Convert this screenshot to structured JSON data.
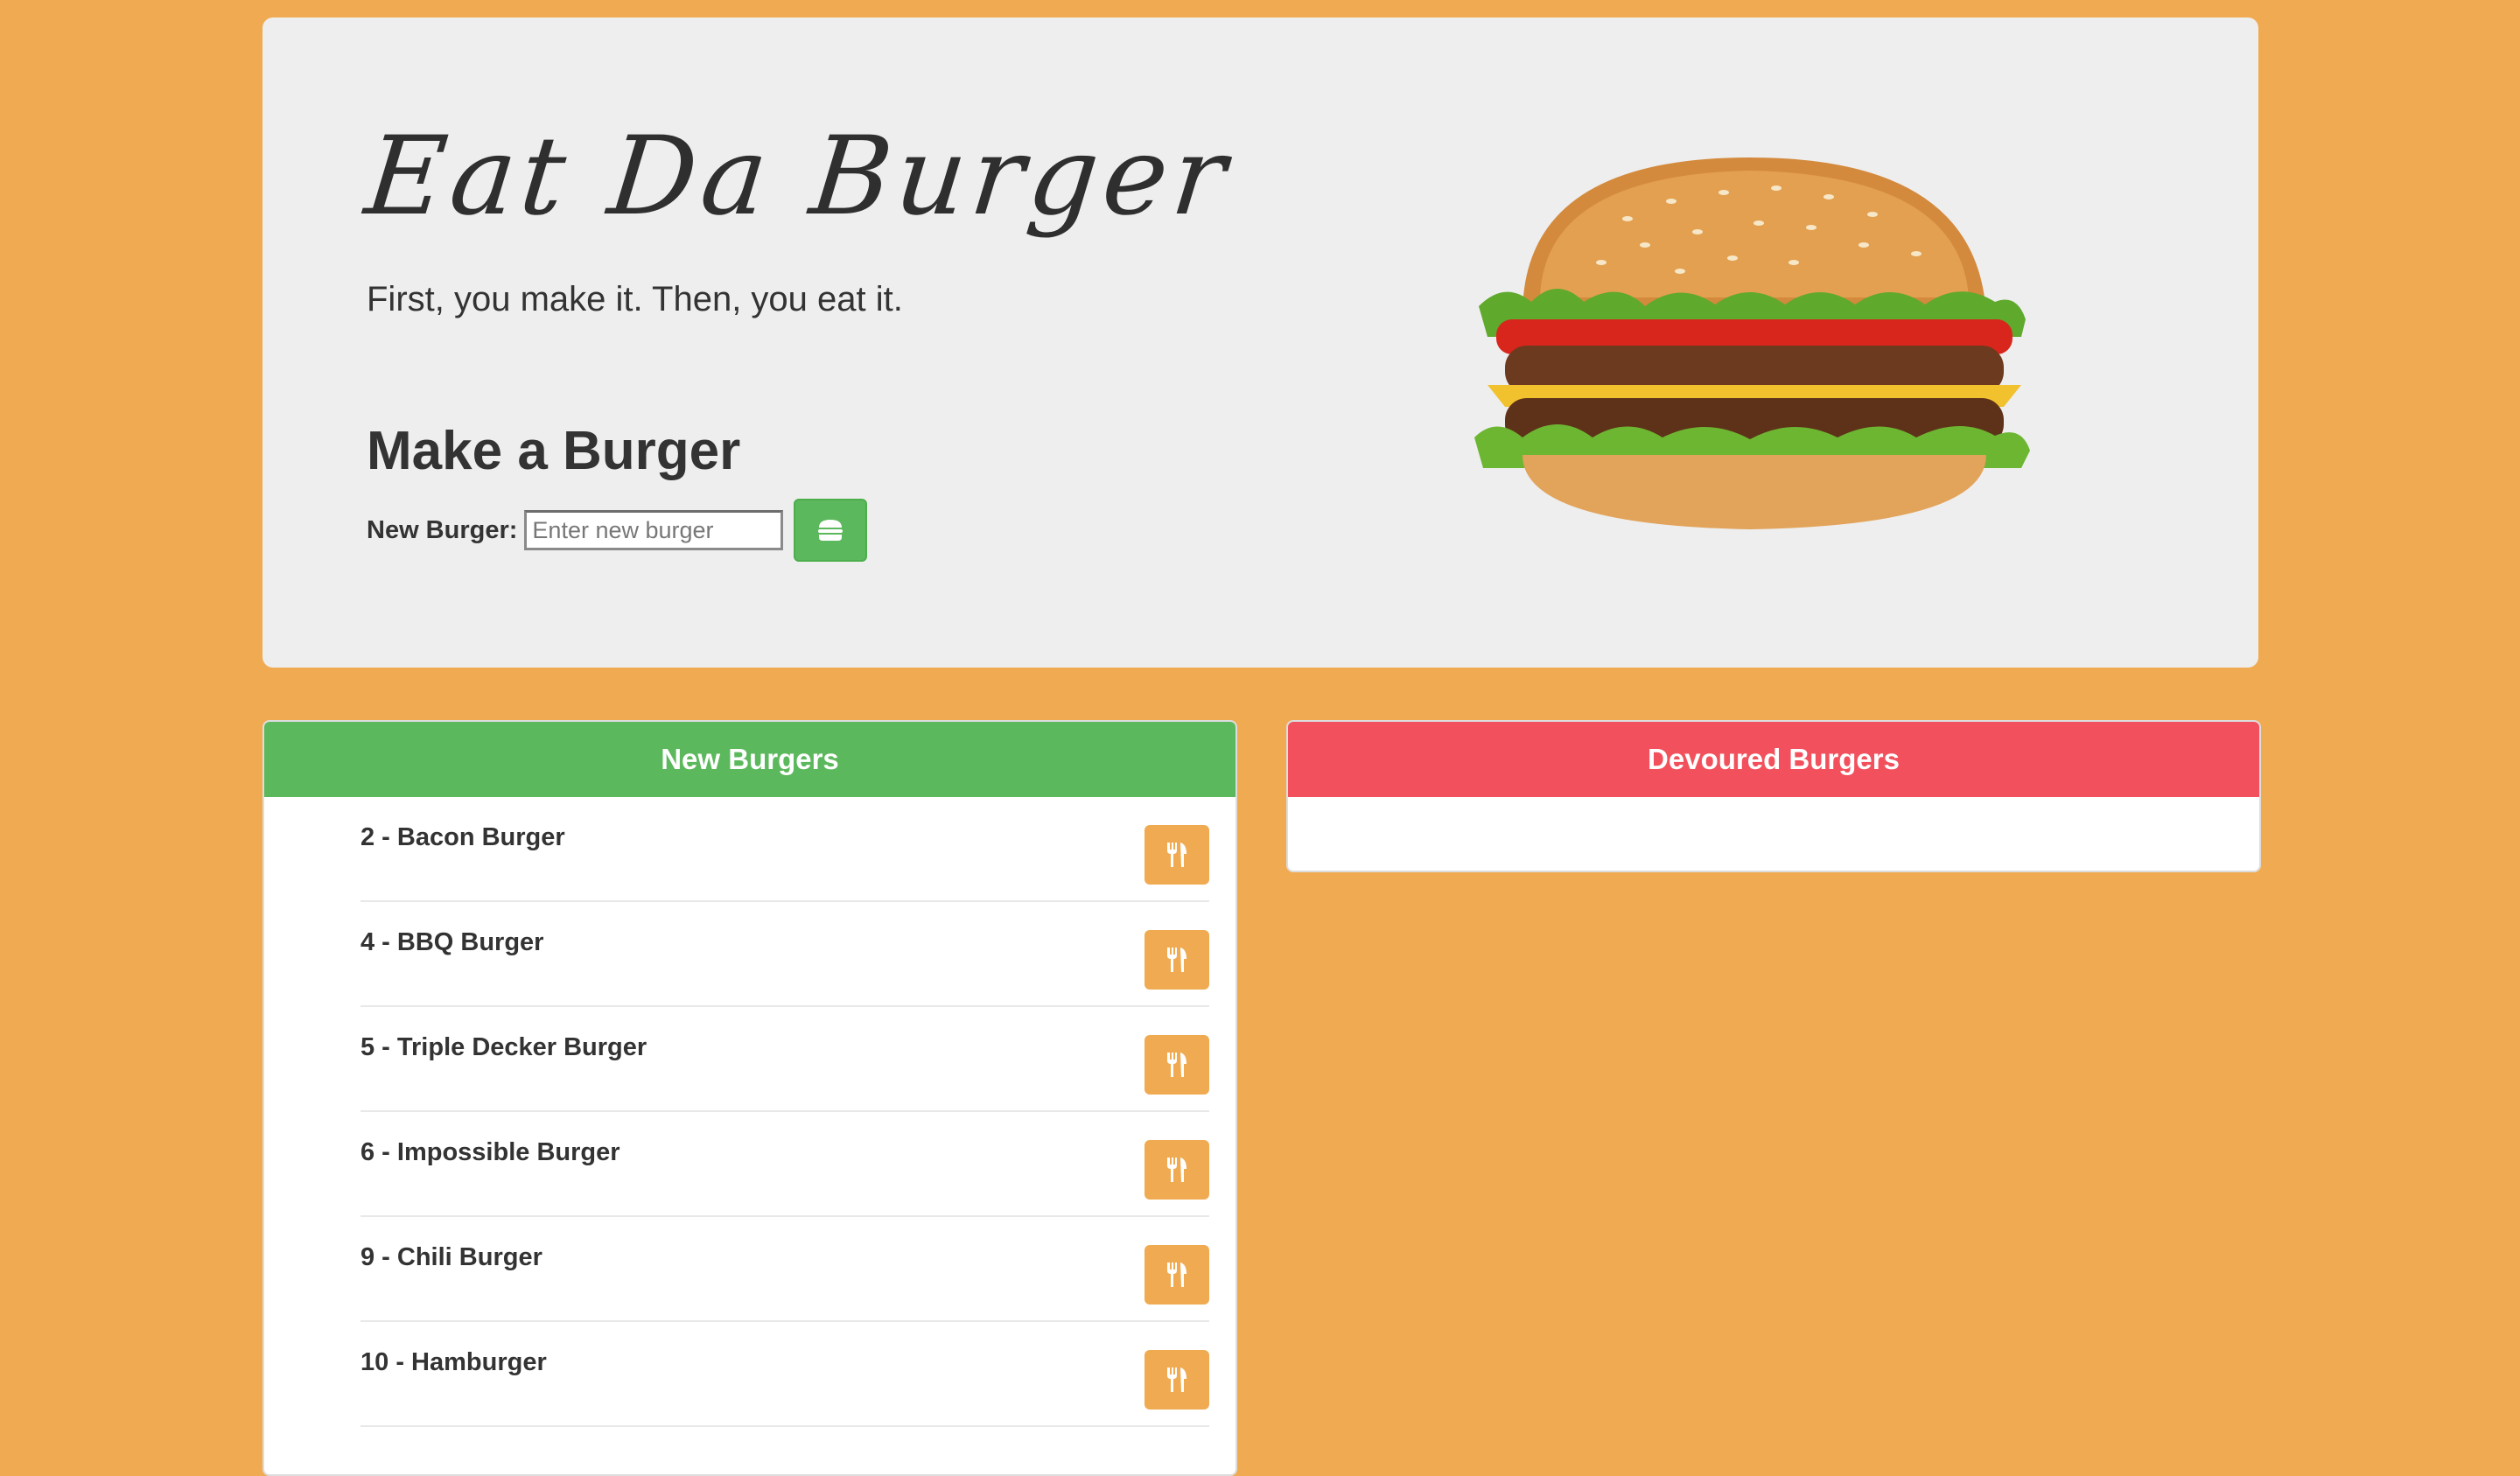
{
  "header": {
    "title": "Eat Da Burger",
    "subtitle": "First, you make it. Then, you eat it."
  },
  "form": {
    "heading": "Make a Burger",
    "label": "New Burger:",
    "placeholder": "Enter new burger",
    "submit_icon": "burger-icon"
  },
  "new_panel": {
    "title": "New Burgers",
    "items": [
      {
        "label": "2 - Bacon Burger",
        "icon": "utensils-icon"
      },
      {
        "label": "4 - BBQ Burger",
        "icon": "utensils-icon"
      },
      {
        "label": "5 - Triple Decker Burger",
        "icon": "utensils-icon"
      },
      {
        "label": "6 - Impossible Burger",
        "icon": "utensils-icon"
      },
      {
        "label": "9 - Chili Burger",
        "icon": "utensils-icon"
      },
      {
        "label": "10 - Hamburger",
        "icon": "utensils-icon"
      }
    ]
  },
  "devoured_panel": {
    "title": "Devoured Burgers",
    "items": []
  },
  "colors": {
    "background": "#f0ab52",
    "new_header": "#5cb85c",
    "devoured_header": "#f2505c",
    "eat_button": "#f0ab52"
  }
}
